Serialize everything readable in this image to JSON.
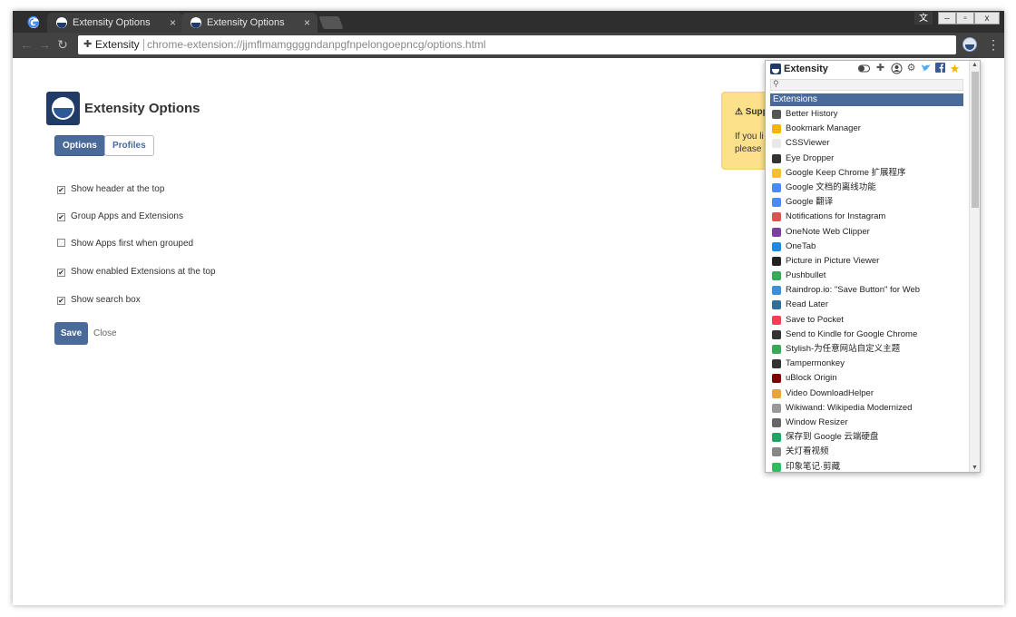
{
  "browser": {
    "tabs": [
      {
        "title": "Extensity Options"
      },
      {
        "title": "Extensity Options"
      }
    ],
    "tab_close": "×",
    "window_controls": [
      "文",
      "–",
      "▫",
      "x"
    ],
    "nav": {
      "back": "←",
      "forward": "→",
      "reload": "↻"
    },
    "omnibox": {
      "site_name": "Extensity",
      "url": "chrome-extension://jjmflmamggggndanpgfnpelongoepncg/options.html"
    },
    "menu": "⋮"
  },
  "options_page": {
    "title": "Extensity Options",
    "tabs": [
      "Options",
      "Profiles"
    ],
    "options": [
      {
        "label": "Show header at the top",
        "checked": true
      },
      {
        "label": "Group Apps and Extensions",
        "checked": true
      },
      {
        "label": "Show Apps first when grouped",
        "checked": false
      },
      {
        "label": "Show enabled Extensions at the top",
        "checked": true
      },
      {
        "label": "Show search box",
        "checked": true
      }
    ],
    "save_label": "Save",
    "close_label": "Close",
    "support": {
      "title": "⚠ Supp",
      "line1": "If you li",
      "line2": "please"
    }
  },
  "popup": {
    "title": "Extensity",
    "header_icons": [
      "toggle-icon",
      "puzzle-icon",
      "profile-icon",
      "gear-icon",
      "twitter-icon",
      "facebook-icon",
      "star-icon"
    ],
    "section": "Extensions",
    "items": [
      {
        "label": "Better History",
        "color": "#555555"
      },
      {
        "label": "Bookmark Manager",
        "color": "#f5b400"
      },
      {
        "label": "CSSViewer",
        "color": "#e8e8e8"
      },
      {
        "label": "Eye Dropper",
        "color": "#333333"
      },
      {
        "label": "Google Keep Chrome 扩展程序",
        "color": "#f6c026"
      },
      {
        "label": "Google 文档的离线功能",
        "color": "#4a8af4"
      },
      {
        "label": "Google 翻译",
        "color": "#4a8af4"
      },
      {
        "label": "Notifications for Instagram",
        "color": "#d9534f"
      },
      {
        "label": "OneNote Web Clipper",
        "color": "#7b3fa0"
      },
      {
        "label": "OneTab",
        "color": "#1e88e5"
      },
      {
        "label": "Picture in Picture Viewer",
        "color": "#222222"
      },
      {
        "label": "Pushbullet",
        "color": "#3aaa5a"
      },
      {
        "label": "Raindrop.io: \"Save Button\" for Web",
        "color": "#3d8fd8"
      },
      {
        "label": "Read Later",
        "color": "#2e6f9e"
      },
      {
        "label": "Save to Pocket",
        "color": "#ef4056"
      },
      {
        "label": "Send to Kindle for Google Chrome",
        "color": "#333333"
      },
      {
        "label": "Stylish-为任意网站自定义主题",
        "color": "#3aaa5a"
      },
      {
        "label": "Tampermonkey",
        "color": "#333333"
      },
      {
        "label": "uBlock Origin",
        "color": "#800000"
      },
      {
        "label": "Video DownloadHelper",
        "color": "#e8a33d"
      },
      {
        "label": "Wikiwand: Wikipedia Modernized",
        "color": "#999999"
      },
      {
        "label": "Window Resizer",
        "color": "#666666"
      },
      {
        "label": "保存到 Google 云端硬盘",
        "color": "#1fa463"
      },
      {
        "label": "关灯看视频",
        "color": "#888888"
      },
      {
        "label": "印象笔记·剪藏",
        "color": "#2dbe60"
      }
    ]
  }
}
